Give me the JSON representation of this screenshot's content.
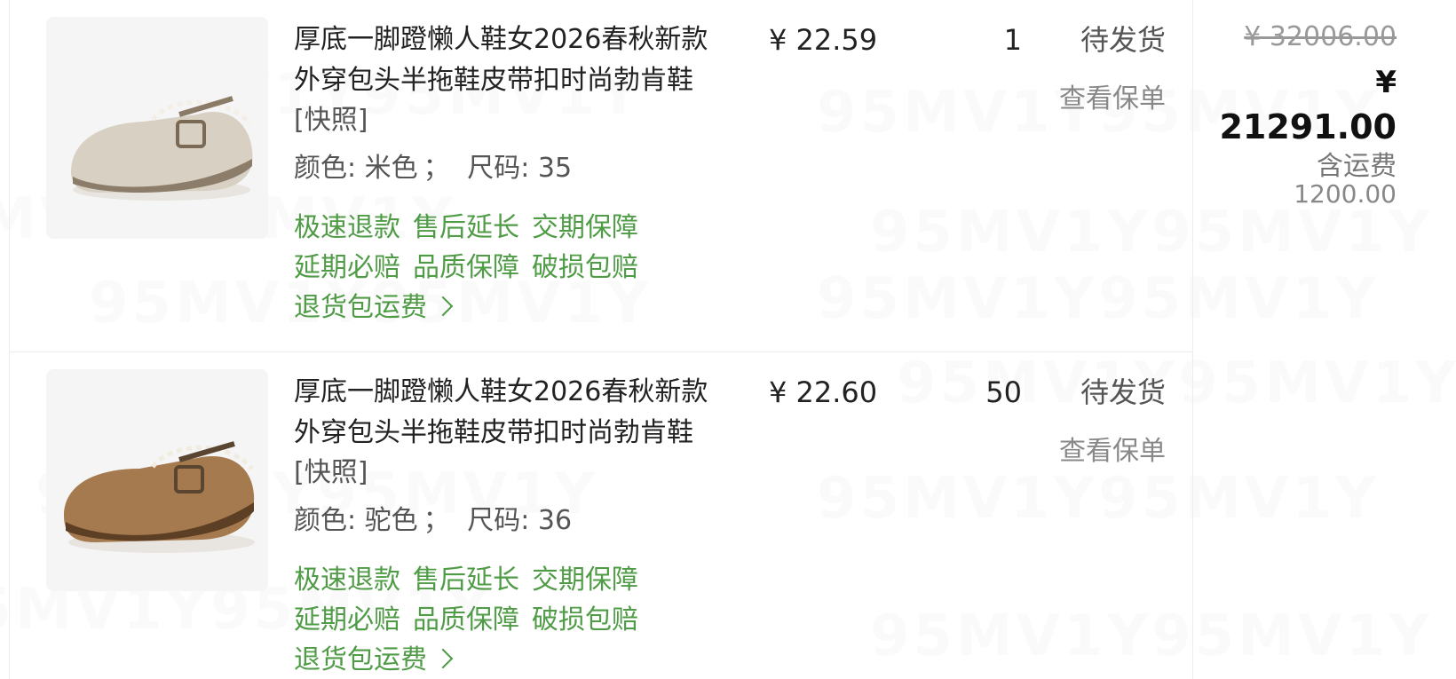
{
  "watermark": "95MV1Y95MV1Y",
  "items": [
    {
      "title": "厚底一脚蹬懒人鞋女2026春秋新款外穿包头半拖鞋皮带扣时尚勃肯鞋",
      "snapshot_label": "[快照]",
      "color_label": "颜色:",
      "color_value": "米色",
      "size_label": "尺码:",
      "size_value": "35",
      "tags": [
        "极速退款",
        "售后延长",
        "交期保障",
        "延期必赔",
        "品质保障",
        "破损包赔"
      ],
      "return_shipping_label": "退货包运费",
      "unit_price": "¥ 22.59",
      "quantity": "1",
      "status": "待发货",
      "policy_link": "查看保单",
      "image_color": "#d8d0c2"
    },
    {
      "title": "厚底一脚蹬懒人鞋女2026春秋新款外穿包头半拖鞋皮带扣时尚勃肯鞋",
      "snapshot_label": "[快照]",
      "color_label": "颜色:",
      "color_value": "驼色",
      "size_label": "尺码:",
      "size_value": "36",
      "tags": [
        "极速退款",
        "售后延长",
        "交期保障",
        "延期必赔",
        "品质保障",
        "破损包赔"
      ],
      "return_shipping_label": "退货包运费",
      "unit_price": "¥ 22.60",
      "quantity": "50",
      "status": "待发货",
      "policy_link": "查看保单",
      "image_color": "#a67a4f"
    }
  ],
  "order_total": {
    "original": "¥ 32006.00",
    "currency": "¥",
    "amount": "21291.00",
    "shipping_label": "含运费",
    "shipping_value": "1200.00"
  },
  "colors": {
    "tag_green": "#4f9b46",
    "border": "#ececec",
    "text_dark": "#222222",
    "text_muted": "#888888"
  }
}
